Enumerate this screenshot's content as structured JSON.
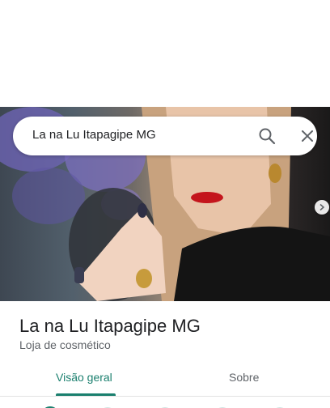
{
  "search": {
    "query": "La na Lu Itapagipe MG"
  },
  "place": {
    "name": "La na Lu Itapagipe MG",
    "category": "Loja de cosmético"
  },
  "tabs": [
    {
      "label": "Visão geral",
      "selected": true
    },
    {
      "label": "Sobre",
      "selected": false
    }
  ],
  "icons": {
    "search": "search-icon",
    "close": "close-icon",
    "next": "chevron-right-icon"
  },
  "colors": {
    "accent": "#1a7f6e",
    "text_primary": "#202124",
    "text_secondary": "#5f6368"
  }
}
